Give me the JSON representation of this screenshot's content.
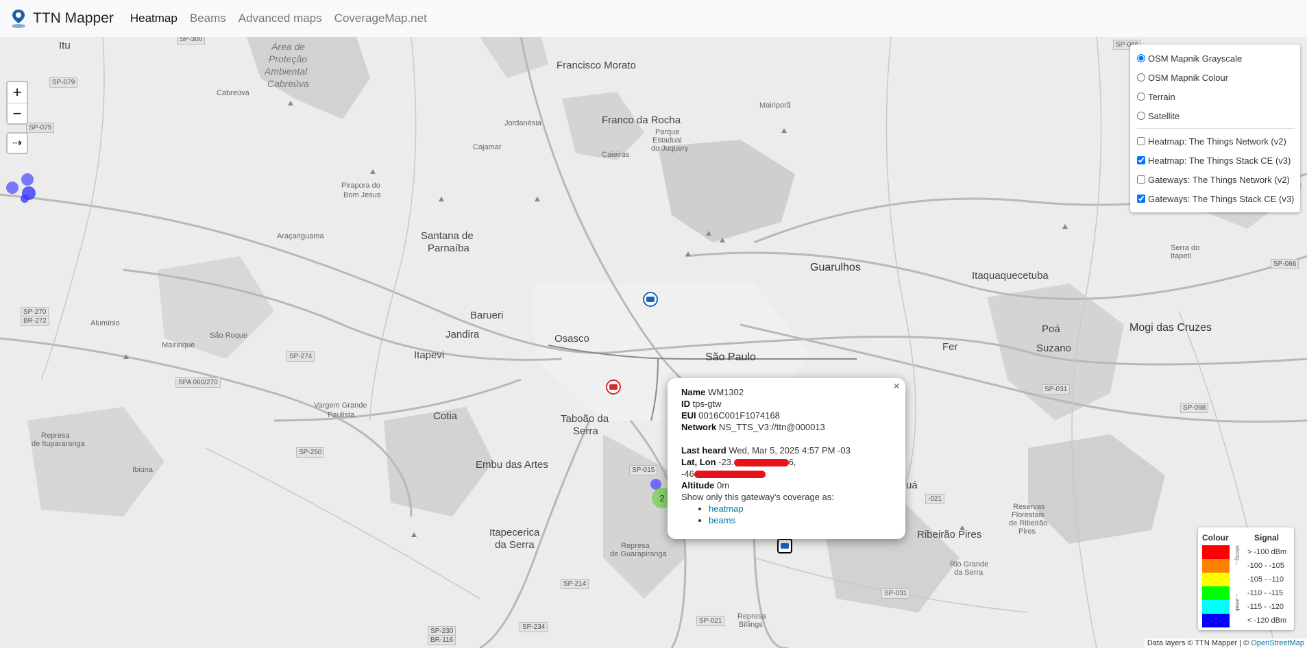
{
  "navbar": {
    "brand": "TTN Mapper",
    "links": [
      "Heatmap",
      "Beams",
      "Advanced maps",
      "CoverageMap.net"
    ]
  },
  "zoom": {
    "in": "+",
    "out": "−",
    "locate": "⇢"
  },
  "layers": {
    "base": [
      {
        "label": "OSM Mapnik Grayscale",
        "checked": true
      },
      {
        "label": "OSM Mapnik Colour",
        "checked": false
      },
      {
        "label": "Terrain",
        "checked": false
      },
      {
        "label": "Satellite",
        "checked": false
      }
    ],
    "overlays": [
      {
        "label": "Heatmap: The Things Network (v2)",
        "checked": false
      },
      {
        "label": "Heatmap: The Things Stack CE (v3)",
        "checked": true
      },
      {
        "label": "Gateways: The Things Network (v2)",
        "checked": false
      },
      {
        "label": "Gateways: The Things Stack CE (v3)",
        "checked": true
      }
    ]
  },
  "popup": {
    "name_label": "Name",
    "name": "WM1302",
    "id_label": "ID",
    "id": "tps-gtw",
    "eui_label": "EUI",
    "eui": "0016C001F1074168",
    "network_label": "Network",
    "network": "NS_TTS_V3://ttn@000013",
    "last_heard_label": "Last heard",
    "last_heard": "Wed, Mar 5, 2025 4:57 PM -03",
    "latlon_label": "Lat, Lon",
    "lat_prefix": "-23.",
    "lat_suffix": "6,",
    "lon_prefix": "-46",
    "altitude_label": "Altitude",
    "altitude": "0m",
    "show_text": "Show only this gateway's coverage as:",
    "links": [
      "heatmap",
      "beams"
    ],
    "close": "×"
  },
  "legend": {
    "colour_header": "Colour",
    "signal_header": "Signal",
    "strong_label": "strong→",
    "weak_label": "←weak",
    "rows": [
      {
        "color": "#ff0000",
        "signal": "> -100 dBm"
      },
      {
        "color": "#ff7f00",
        "signal": "-100 - -105"
      },
      {
        "color": "#ffff00",
        "signal": "-105 - -110"
      },
      {
        "color": "#00ff00",
        "signal": "-110 - -115"
      },
      {
        "color": "#00ffff",
        "signal": "-115 - -120"
      },
      {
        "color": "#0000ff",
        "signal": "< -120 dBm"
      }
    ]
  },
  "attribution": {
    "text": "Data layers © TTN Mapper | © ",
    "link": "OpenStreetMap"
  },
  "cluster_count": "2",
  "places": [
    {
      "t": "Itu",
      "c": "city"
    },
    {
      "t": "Cabreúva",
      "c": "small"
    },
    {
      "t": "Área de",
      "c": "italic"
    },
    {
      "t": "Proteção",
      "c": "italic"
    },
    {
      "t": "Ambiental",
      "c": "italic"
    },
    {
      "t": "Cabreúva",
      "c": "italic"
    },
    {
      "t": "Francisco Morato",
      "c": "city"
    },
    {
      "t": "Franco da Rocha",
      "c": "city"
    },
    {
      "t": "Parque",
      "c": "small"
    },
    {
      "t": "Estadual",
      "c": "small"
    },
    {
      "t": "do Juquery",
      "c": "small"
    },
    {
      "t": "Mairiporã",
      "c": "small"
    },
    {
      "t": "Jordanésia",
      "c": "small"
    },
    {
      "t": "Cajamar",
      "c": "small"
    },
    {
      "t": "Caieiras",
      "c": "small"
    },
    {
      "t": "Pirapora do",
      "c": "small"
    },
    {
      "t": "Bom Jesus",
      "c": "small"
    },
    {
      "t": "Araçariguama",
      "c": "small"
    },
    {
      "t": "Santana de",
      "c": "city"
    },
    {
      "t": "Parnaíba",
      "c": "city"
    },
    {
      "t": "Guarulhos",
      "c": "big"
    },
    {
      "t": "Itaquaquecetuba",
      "c": "city"
    },
    {
      "t": "Serra do",
      "c": "small"
    },
    {
      "t": "Itapeti",
      "c": "small"
    },
    {
      "t": "Barueri",
      "c": "city"
    },
    {
      "t": "Jandira",
      "c": "city"
    },
    {
      "t": "Osasco",
      "c": "city"
    },
    {
      "t": "São Paulo",
      "c": "big"
    },
    {
      "t": "Alumínio",
      "c": "small"
    },
    {
      "t": "São Roque",
      "c": "small"
    },
    {
      "t": "Mairinque",
      "c": "small"
    },
    {
      "t": "Itapevi",
      "c": "city"
    },
    {
      "t": "Poá",
      "c": "city"
    },
    {
      "t": "Mogi das Cruzes",
      "c": "big"
    },
    {
      "t": "Suzano",
      "c": "city"
    },
    {
      "t": "Fer",
      "c": "city"
    },
    {
      "t": "Vargem Grande",
      "c": "small"
    },
    {
      "t": "Paulista",
      "c": "small"
    },
    {
      "t": "Cotia",
      "c": "city"
    },
    {
      "t": "Taboão da",
      "c": "city"
    },
    {
      "t": "Serra",
      "c": "city"
    },
    {
      "t": "Represa",
      "c": "small"
    },
    {
      "t": "de Itupararanga",
      "c": "small"
    },
    {
      "t": "Embu das Artes",
      "c": "city"
    },
    {
      "t": "Ibiúna",
      "c": "small"
    },
    {
      "t": "Itapecerica",
      "c": "city"
    },
    {
      "t": "da Serra",
      "c": "city"
    },
    {
      "t": "Represa",
      "c": "small"
    },
    {
      "t": "de Guarapiranga",
      "c": "small"
    },
    {
      "t": "Ribeirão Pires",
      "c": "city"
    },
    {
      "t": "Reservas",
      "c": "small"
    },
    {
      "t": "Florestais",
      "c": "small"
    },
    {
      "t": "de Ribeirão",
      "c": "small"
    },
    {
      "t": "Pires",
      "c": "small"
    },
    {
      "t": "Rio Grande",
      "c": "small"
    },
    {
      "t": "da Serra",
      "c": "small"
    },
    {
      "t": "Represa",
      "c": "small"
    },
    {
      "t": "Billings",
      "c": "small"
    },
    {
      "t": "uá",
      "c": "city"
    }
  ],
  "shields": [
    "SP-300",
    "SP-079",
    "SP-075",
    "SP-270",
    "BR-272",
    "SP-274",
    "SPA 060/270",
    "SP-250",
    "SP-015",
    "SP-214",
    "SP-230",
    "BR-116",
    "SP-234",
    "SP-021",
    "SP-031",
    "SP-066",
    "SP-098",
    "SP-031",
    "SP-066",
    "-021"
  ]
}
